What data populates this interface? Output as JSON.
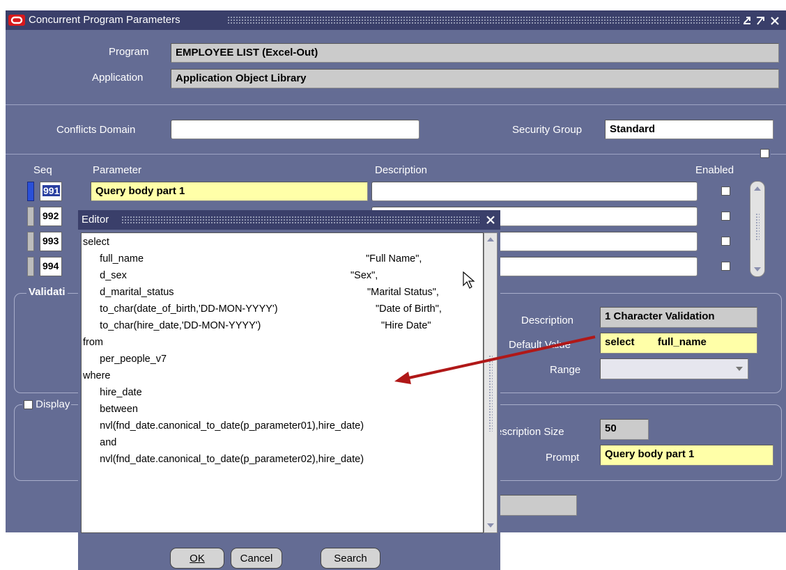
{
  "main": {
    "title": "Concurrent Program Parameters",
    "program_label": "Program",
    "program_value": "EMPLOYEE LIST (Excel-Out)",
    "application_label": "Application",
    "application_value": "Application Object Library",
    "conflicts_domain_label": "Conflicts Domain",
    "conflicts_domain_value": "",
    "security_group_label": "Security Group",
    "security_group_value": "Standard",
    "columns": {
      "seq": "Seq",
      "parameter": "Parameter",
      "description": "Description",
      "enabled": "Enabled"
    },
    "rows": [
      {
        "seq": "991",
        "parameter": "Query body part 1",
        "description": "",
        "enabled": false
      },
      {
        "seq": "992",
        "parameter": "",
        "description": "",
        "enabled": false
      },
      {
        "seq": "993",
        "parameter": "",
        "description": "",
        "enabled": false
      },
      {
        "seq": "994",
        "parameter": "",
        "description": "",
        "enabled": false
      }
    ],
    "validation_label": "Validati",
    "vs_description_label": "Description",
    "vs_description_value": "1 Character Validation",
    "default_value_label": "Default Value",
    "default_value_value": "select        full_name",
    "range_label": "Range",
    "range_value": "",
    "display_label": "Display",
    "description_size_label": "escription Size",
    "description_size_value": "50",
    "prompt_label": "Prompt",
    "prompt_value": "Query body part 1"
  },
  "editor": {
    "title": "Editor",
    "lines": [
      "select",
      "      full_name",
      "      d_sex",
      "      d_marital_status",
      "      to_char(date_of_birth,'DD-MON-YYYY')",
      "      to_char(hire_date,'DD-MON-YYYY')",
      "from",
      "      per_people_v7",
      "where",
      "      hire_date",
      "      between",
      "      nvl(fnd_date.canonical_to_date(p_parameter01),hire_date)",
      "      and",
      "      nvl(fnd_date.canonical_to_date(p_parameter02),hire_date)"
    ],
    "aliases": [
      "\"Full Name\",",
      "\"Sex\",",
      "\"Marital Status\",",
      "\"Date of Birth\",",
      "\"Hire Date\""
    ],
    "ok_label": "OK",
    "cancel_label": "Cancel",
    "search_label": "Search"
  },
  "colors": {
    "window_bg": "#646c94",
    "titlebar": "#3a3f6a",
    "arrow": "#b01818",
    "field_yellow": "#ffffa8"
  }
}
